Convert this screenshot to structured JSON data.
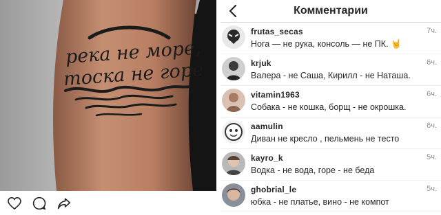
{
  "header": {
    "title": "Комментарии"
  },
  "photo": {
    "tattoo_line1": "река не море,",
    "tattoo_line2": "тоска не горе"
  },
  "actions": [
    {
      "icon": "heart-icon"
    },
    {
      "icon": "comment-icon"
    },
    {
      "icon": "share-icon"
    }
  ],
  "comments": [
    {
      "user": "frutas_secas",
      "text": "Нога — не рука, консоль — не ПК.",
      "time": "7ч.",
      "emoji": "🤘"
    },
    {
      "user": "krjuk",
      "text": "Валера - не Саша, Кирилл - не Наташа.",
      "time": "6ч."
    },
    {
      "user": "vitamin1963",
      "text": "Собака - не кошка, борщ - не окрошка.",
      "time": "6ч."
    },
    {
      "user": "aamulin",
      "text": "Диван не кресло , пельмень не тесто",
      "time": "6ч."
    },
    {
      "user": "kayro_k",
      "text": "Водка - не вода, горе - не беда",
      "time": "5ч."
    },
    {
      "user": "ghobrial_le",
      "text": "юбка - не платье, вино - не компот",
      "time": "5ч."
    }
  ]
}
